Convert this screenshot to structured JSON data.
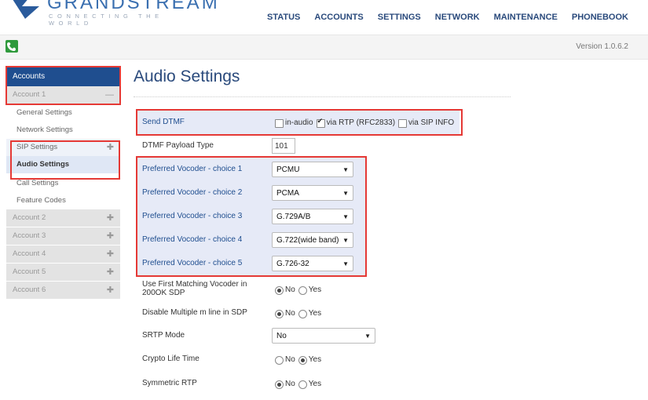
{
  "header": {
    "logo_wordmark": "GRANDSTREAM",
    "logo_tagline": "CONNECTING THE WORLD",
    "nav": [
      "STATUS",
      "ACCOUNTS",
      "SETTINGS",
      "NETWORK",
      "MAINTENANCE",
      "PHONEBOOK"
    ]
  },
  "bar": {
    "version": "Version 1.0.6.2"
  },
  "sidebar": {
    "header": "Accounts",
    "account1": "Account 1",
    "sub_items": [
      "General Settings",
      "Network Settings",
      "SIP Settings",
      "Audio Settings",
      "Call Settings",
      "Feature Codes"
    ],
    "other_accounts": [
      "Account 2",
      "Account 3",
      "Account 4",
      "Account 5",
      "Account 6"
    ]
  },
  "main": {
    "title": "Audio Settings",
    "send_dtmf": {
      "label": "Send DTMF",
      "options": [
        "in-audio",
        "via RTP (RFC2833)",
        "via SIP INFO"
      ]
    },
    "payload": {
      "label": "DTMF Payload Type",
      "value": "101"
    },
    "vocoders": [
      {
        "label": "Preferred Vocoder - choice 1",
        "value": "PCMU"
      },
      {
        "label": "Preferred Vocoder - choice 2",
        "value": "PCMA"
      },
      {
        "label": "Preferred Vocoder - choice 3",
        "value": "G.729A/B"
      },
      {
        "label": "Preferred Vocoder - choice 4",
        "value": "G.722(wide band)"
      },
      {
        "label": "Preferred Vocoder - choice 5",
        "value": "G.726-32"
      }
    ],
    "first_match": {
      "label_line1": "Use First Matching Vocoder in",
      "label_line2": "200OK SDP"
    },
    "disable_m": {
      "label": "Disable Multiple m line in SDP"
    },
    "srtp": {
      "label": "SRTP Mode",
      "value": "No"
    },
    "crypto": {
      "label": "Crypto Life Time"
    },
    "symmetric": {
      "label": "Symmetric RTP"
    },
    "no": "No",
    "yes": "Yes"
  }
}
